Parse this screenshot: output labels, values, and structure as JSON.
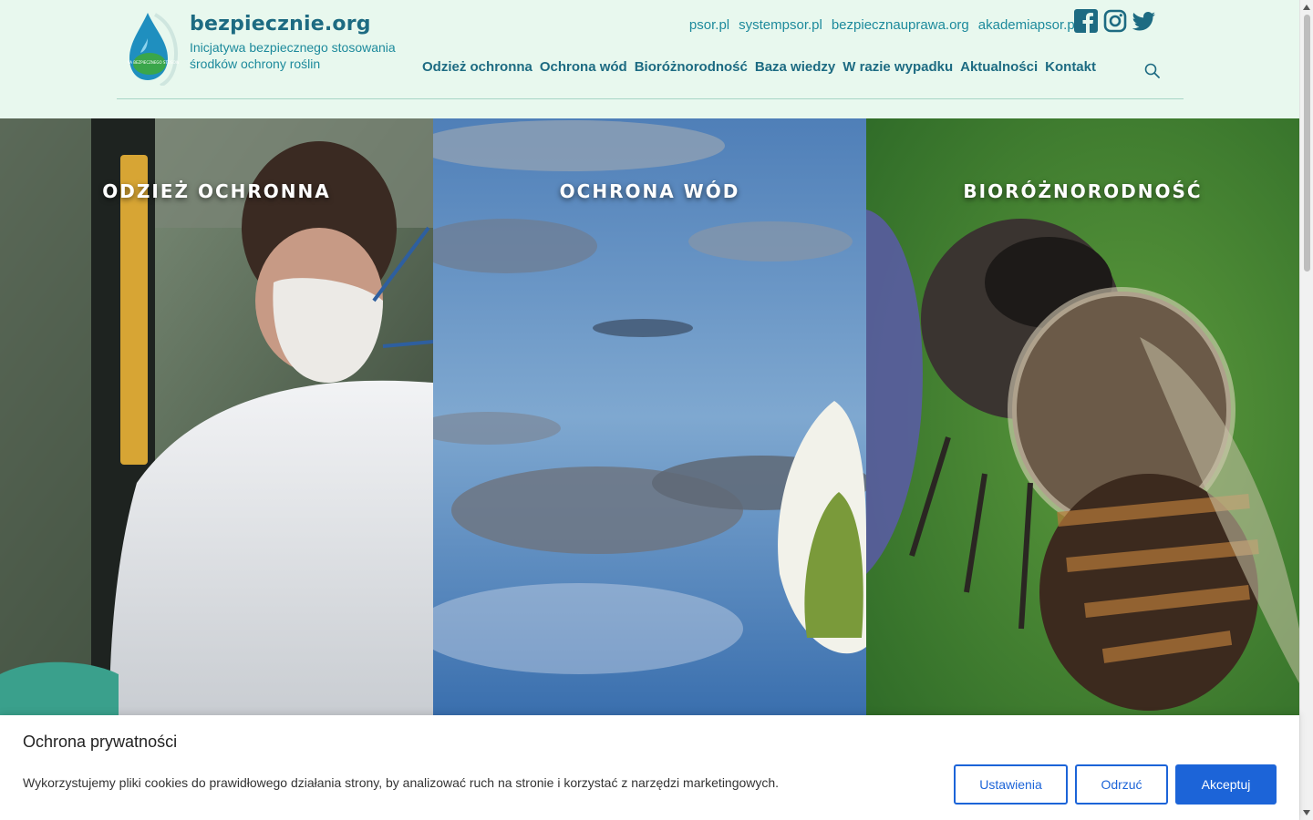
{
  "brand": {
    "name": "bezpiecznie.org",
    "tagline": "Inicjatywa bezpiecznego stosowania środków ochrony roślin",
    "logo_text": "INICJATYWA BEZPIECZNEGO STOSOWANIA"
  },
  "toplinks": [
    "psor.pl",
    "systempsor.pl",
    "bezpiecznauprawa.org",
    "akademiapsor.pl"
  ],
  "social": [
    {
      "icon": "facebook-icon"
    },
    {
      "icon": "instagram-icon"
    },
    {
      "icon": "twitter-icon"
    }
  ],
  "nav": [
    "Odzież ochronna",
    "Ochrona wód",
    "Bioróżnorodność",
    "Baza wiedzy",
    "W razie wypadku",
    "Aktualności",
    "Kontakt"
  ],
  "tiles": [
    {
      "label": "ODZIEŻ OCHRONNA"
    },
    {
      "label": "OCHRONA WÓD"
    },
    {
      "label": "BIORÓŻNORODNOŚĆ"
    }
  ],
  "cookie": {
    "title": "Ochrona prywatności",
    "text": "Wykorzystujemy pliki cookies do prawidłowego działania strony, by analizować ruch na stronie i korzystać z narzędzi marketingowych.",
    "settings": "Ustawienia",
    "reject": "Odrzuć",
    "accept": "Akceptuj"
  },
  "colors": {
    "header_bg": "#e8f8ee",
    "brand": "#1d6b82",
    "accent_button": "#1c64d8"
  }
}
